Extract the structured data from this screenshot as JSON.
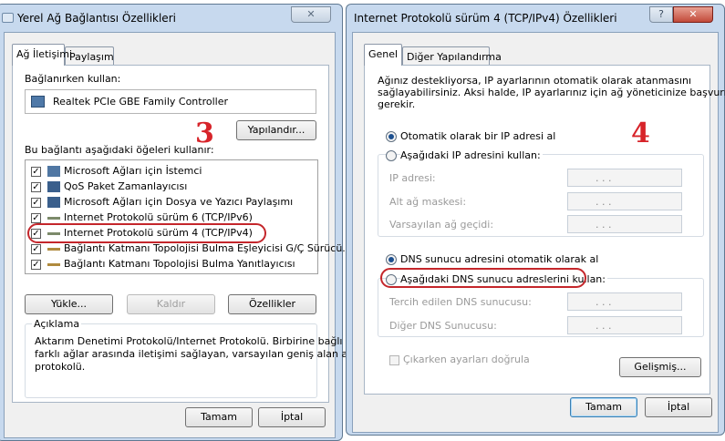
{
  "left": {
    "title": "Yerel Ağ Bağlantısı Özellikleri",
    "tabs": [
      "Ağ İletişimi",
      "Paylaşım"
    ],
    "connect_label": "Bağlanırken kullan:",
    "adapter": "Realtek PCIe GBE Family Controller",
    "configure_btn": "Yapılandır...",
    "items_label": "Bu bağlantı aşağıdaki öğeleri kullanır:",
    "items": [
      "Microsoft Ağları için İstemci",
      "QoS Paket Zamanlayıcısı",
      "Microsoft Ağları için Dosya ve Yazıcı Paylaşımı",
      "Internet Protokolü sürüm 6 (TCP/IPv6)",
      "Internet Protokolü sürüm 4 (TCP/IPv4)",
      "Bağlantı Katmanı Topolojisi Bulma Eşleyicisi G/Ç Sürücü...",
      "Bağlantı Katmanı Topolojisi Bulma Yanıtlayıcısı"
    ],
    "install_btn": "Yükle...",
    "uninstall_btn": "Kaldır",
    "properties_btn": "Özellikler",
    "desc_title": "Açıklama",
    "desc_lines": [
      "Aktarım Denetimi Protokolü/Internet Protokolü. Birbirine bağlı",
      "farklı ağlar arasında iletişimi sağlayan, varsayılan geniş alan ağı",
      "protokolü."
    ],
    "ok_btn": "Tamam",
    "cancel_btn": "İptal",
    "marker": "3"
  },
  "right": {
    "title": "Internet Protokolü sürüm 4 (TCP/IPv4) Özellikleri",
    "help": "?",
    "close": "✕",
    "tabs": [
      "Genel",
      "Diğer Yapılandırma"
    ],
    "intro_lines": [
      "Ağınız destekliyorsa, IP ayarlarının otomatik olarak atanmasını",
      "sağlayabilirsiniz. Aksi halde, IP ayarlarınız için ağ yöneticinize başvurmanız",
      "gerekir."
    ],
    "auto_ip": "Otomatik olarak bir IP adresi al",
    "manual_ip": "Aşağıdaki IP adresini kullan:",
    "ip_fields": [
      "IP adresi:",
      "Alt ağ maskesi:",
      "Varsayılan ağ geçidi:"
    ],
    "ip_dots": ".        .        .",
    "auto_dns": "DNS sunucu adresini otomatik olarak al",
    "manual_dns": "Aşağıdaki DNS sunucu adreslerini kullan:",
    "dns_fields": [
      "Tercih edilen DNS sunucusu:",
      "Diğer DNS Sunucusu:"
    ],
    "validate": "Çıkarken ayarları doğrula",
    "advanced_btn": "Gelişmiş...",
    "ok_btn": "Tamam",
    "cancel_btn": "İptal",
    "marker": "4"
  },
  "left_close": "✕"
}
